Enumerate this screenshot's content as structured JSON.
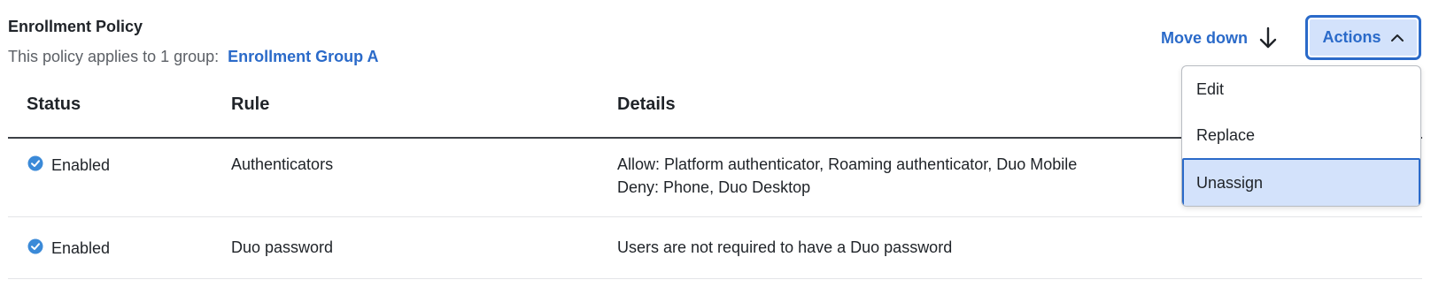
{
  "policy": {
    "title": "Enrollment Policy",
    "applies_text": "This policy applies to 1 group:",
    "group_link": "Enrollment Group A"
  },
  "toolbar": {
    "move_down_label": "Move down",
    "move_down_icon": "arrow-down-icon",
    "actions_label": "Actions",
    "actions_icon": "chevron-up-icon"
  },
  "colors": {
    "accent": "#2a6ac9",
    "accent_light": "#d3e2fb",
    "status_enabled": "#3b8ad8"
  },
  "table": {
    "headers": {
      "status": "Status",
      "rule": "Rule",
      "details": "Details"
    },
    "rows": [
      {
        "status": "Enabled",
        "status_icon": "check-circle-icon",
        "rule": "Authenticators",
        "details": [
          "Allow: Platform authenticator, Roaming authenticator, Duo Mobile",
          "Deny: Phone, Duo Desktop"
        ]
      },
      {
        "status": "Enabled",
        "status_icon": "check-circle-icon",
        "rule": "Duo password",
        "details": [
          "Users are not required to have a Duo password"
        ]
      }
    ]
  },
  "actions_menu": {
    "items": [
      "Edit",
      "Replace",
      "Unassign"
    ],
    "highlighted": "Unassign"
  }
}
